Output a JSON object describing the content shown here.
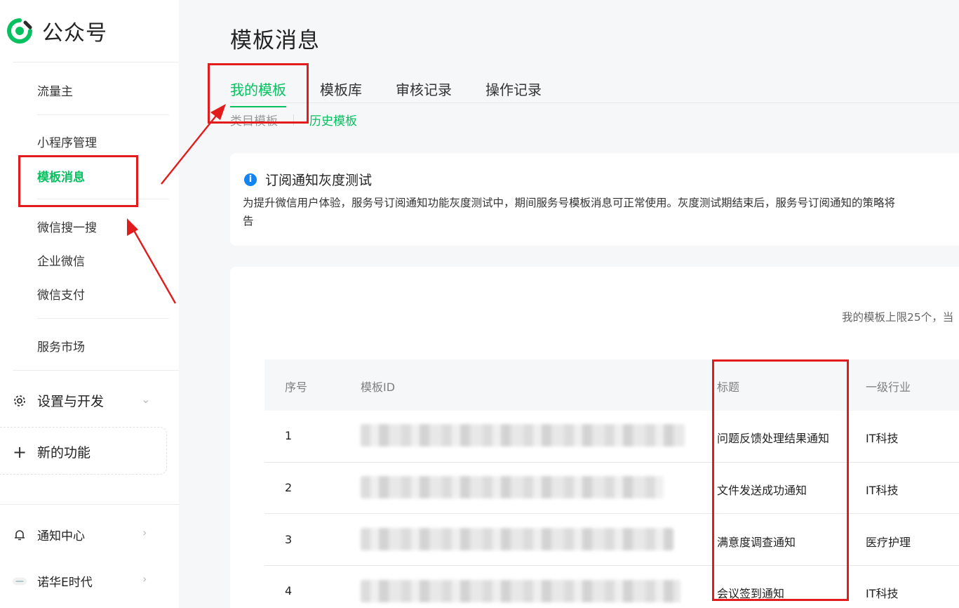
{
  "app": {
    "name": "公众号"
  },
  "sidebar": {
    "items": [
      {
        "label": "流量主"
      },
      {
        "label": "小程序管理"
      },
      {
        "label": "模板消息"
      },
      {
        "label": "微信搜一搜"
      },
      {
        "label": "企业微信"
      },
      {
        "label": "微信支付"
      },
      {
        "label": "服务市场"
      }
    ],
    "settings": {
      "label": "设置与开发",
      "icon": "gear-icon"
    },
    "new_features": {
      "label": "新的功能",
      "icon": "plus-icon"
    },
    "notifications": {
      "label": "通知中心",
      "icon": "bell-icon"
    },
    "account": {
      "label": "诺华E时代"
    }
  },
  "main": {
    "title": "模板消息",
    "tabs": [
      {
        "label": "我的模板",
        "active": true
      },
      {
        "label": "模板库"
      },
      {
        "label": "审核记录"
      },
      {
        "label": "操作记录"
      }
    ],
    "subtabs": [
      {
        "label": "类目模板"
      },
      {
        "label": "历史模板"
      }
    ],
    "notice": {
      "title": "订阅通知灰度测试",
      "body_line1": "为提升微信用户体验，服务号订阅通知功能灰度测试中，期间服务号模板消息可正常使用。灰度测试期结束后，服务号订阅通知的策略将",
      "body_line2": "告"
    },
    "limit_text": "我的模板上限25个，当",
    "table": {
      "headers": [
        "序号",
        "模板ID",
        "标题",
        "一级行业"
      ],
      "rows": [
        {
          "index": "1",
          "title": "问题反馈处理结果通知",
          "industry": "IT科技"
        },
        {
          "index": "2",
          "title": "文件发送成功通知",
          "industry": "IT科技"
        },
        {
          "index": "3",
          "title": "满意度调查通知",
          "industry": "医疗护理"
        },
        {
          "index": "4",
          "title": "会议签到通知",
          "industry": "IT科技"
        }
      ]
    }
  },
  "colors": {
    "accent": "#07c160",
    "annotation": "#e21c1c",
    "info": "#1485ee"
  }
}
